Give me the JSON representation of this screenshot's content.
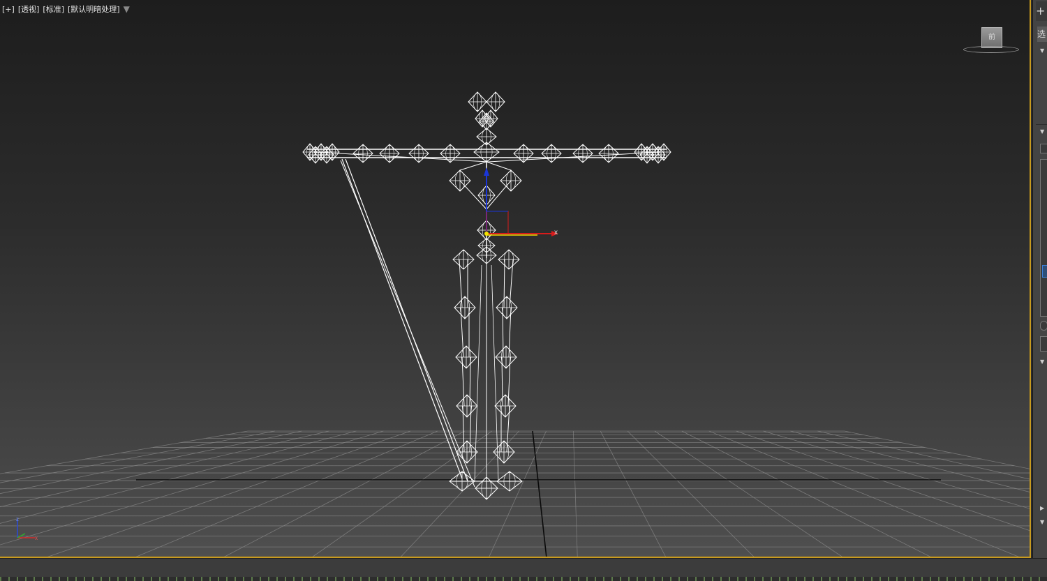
{
  "viewport": {
    "label_items": [
      "[+]",
      "[透视]",
      "[标准]",
      "[默认明暗处理]"
    ],
    "filter_icon": "filter-icon",
    "viewcube_face": "前",
    "axis_labels": {
      "gizmo_x": "x",
      "tripod_x": "x",
      "tripod_z": "z"
    }
  },
  "right_panel": {
    "add_icon": "+",
    "tab_label": "选"
  },
  "colors": {
    "viewport_top": "#1d1d1d",
    "viewport_bottom": "#4f4f4f",
    "active_border": "#c89a1e",
    "wireframe": "#ffffff",
    "grid": "#8a8a8a",
    "axis_x": "#d81b1b",
    "axis_y": "#1fa31f",
    "axis_z": "#1b36d8",
    "gizmo_yellow": "#f2e200"
  }
}
